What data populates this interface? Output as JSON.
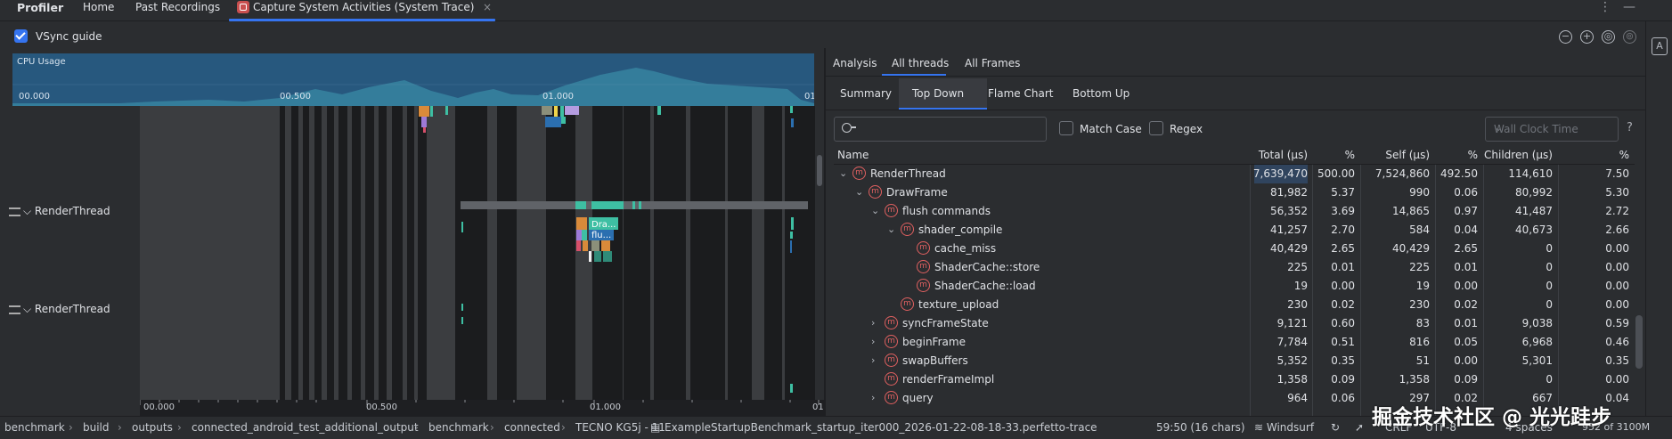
{
  "tabs": {
    "profiler": "Profiler",
    "home": "Home",
    "past_recordings": "Past Recordings",
    "capture": "Capture System Activities (System Trace)",
    "close_symbol": "×"
  },
  "toolbar": {
    "vsync_label": "VSync guide",
    "vsync_checked": true,
    "zoom_out": "−",
    "zoom_in": "+",
    "reset_zoom": "◎",
    "go_live": "⊚"
  },
  "cpu_usage": {
    "title": "CPU Usage",
    "ticks": [
      "00.000",
      "00.500",
      "01.000",
      "01"
    ]
  },
  "tracks": {
    "thread_1": "RenderThread",
    "thread_2": "RenderThread",
    "slice_labels": [
      "Dra...",
      "flu..."
    ]
  },
  "time_axis": {
    "ticks": [
      "00.000",
      "00.500",
      "01.000",
      "01"
    ]
  },
  "analysis": {
    "tabs": [
      "Analysis",
      "All threads",
      "All Frames"
    ],
    "sub_tabs": [
      "Summary",
      "Top Down",
      "Flame Chart",
      "Bottom Up"
    ],
    "search_placeholder": "",
    "match_case": "Match Case",
    "regex": "Regex",
    "clock_select": "Wall Clock Time",
    "help": "?",
    "columns": [
      "Name",
      "Total (μs)",
      "%",
      "Self (μs)",
      "%",
      "Children (μs)",
      "%"
    ],
    "rows": [
      {
        "name": "RenderThread",
        "depth": 0,
        "expand": "open",
        "total": "7,639,470",
        "total_pct": "500.00",
        "self": "7,524,860",
        "self_pct": "492.50",
        "children": "114,610",
        "children_pct": "7.50"
      },
      {
        "name": "DrawFrame",
        "depth": 1,
        "expand": "open",
        "total": "81,982",
        "total_pct": "5.37",
        "self": "990",
        "self_pct": "0.06",
        "children": "80,992",
        "children_pct": "5.30"
      },
      {
        "name": "flush commands",
        "depth": 2,
        "expand": "open",
        "total": "56,352",
        "total_pct": "3.69",
        "self": "14,865",
        "self_pct": "0.97",
        "children": "41,487",
        "children_pct": "2.72"
      },
      {
        "name": "shader_compile",
        "depth": 3,
        "expand": "open",
        "total": "41,257",
        "total_pct": "2.70",
        "self": "584",
        "self_pct": "0.04",
        "children": "40,673",
        "children_pct": "2.66"
      },
      {
        "name": "cache_miss",
        "depth": 4,
        "expand": "none",
        "total": "40,429",
        "total_pct": "2.65",
        "self": "40,429",
        "self_pct": "2.65",
        "children": "0",
        "children_pct": "0.00"
      },
      {
        "name": "ShaderCache::store",
        "depth": 4,
        "expand": "none",
        "total": "225",
        "total_pct": "0.01",
        "self": "225",
        "self_pct": "0.01",
        "children": "0",
        "children_pct": "0.00"
      },
      {
        "name": "ShaderCache::load",
        "depth": 4,
        "expand": "none",
        "total": "19",
        "total_pct": "0.00",
        "self": "19",
        "self_pct": "0.00",
        "children": "0",
        "children_pct": "0.00"
      },
      {
        "name": "texture_upload",
        "depth": 3,
        "expand": "none",
        "total": "230",
        "total_pct": "0.02",
        "self": "230",
        "self_pct": "0.02",
        "children": "0",
        "children_pct": "0.00"
      },
      {
        "name": "syncFrameState",
        "depth": 2,
        "expand": "closed",
        "total": "9,121",
        "total_pct": "0.60",
        "self": "83",
        "self_pct": "0.01",
        "children": "9,038",
        "children_pct": "0.59"
      },
      {
        "name": "beginFrame",
        "depth": 2,
        "expand": "closed",
        "total": "7,784",
        "total_pct": "0.51",
        "self": "816",
        "self_pct": "0.05",
        "children": "6,968",
        "children_pct": "0.46"
      },
      {
        "name": "swapBuffers",
        "depth": 2,
        "expand": "closed",
        "total": "5,352",
        "total_pct": "0.35",
        "self": "51",
        "self_pct": "0.00",
        "children": "5,301",
        "children_pct": "0.35"
      },
      {
        "name": "renderFrameImpl",
        "depth": 2,
        "expand": "none",
        "total": "1,358",
        "total_pct": "0.09",
        "self": "1,358",
        "self_pct": "0.09",
        "children": "0",
        "children_pct": "0.00"
      },
      {
        "name": "query",
        "depth": 2,
        "expand": "closed",
        "total": "964",
        "total_pct": "0.06",
        "self": "297",
        "self_pct": "0.02",
        "children": "667",
        "children_pct": "0.04"
      }
    ]
  },
  "status_bar": {
    "breadcrumbs": [
      "benchmark",
      "build",
      "outputs",
      "connected_android_test_additional_output",
      "benchmark",
      "connected",
      "TECNO KG5j - 11",
      "ExampleStartupBenchmark_startup_iter000_2026-01-22-08-18-33.perfetto-trace"
    ],
    "position": "59:50 (16 chars)",
    "plugin": "Windsurf",
    "line_ending": "CRLF",
    "encoding": "UTF-8",
    "indent": "4 spaces",
    "memory": "952 of 3100M"
  },
  "watermark": "掘金技术社区 @ 光光跬步",
  "colors": {
    "accent": "#3574f0",
    "cpu_fill": "#27587e",
    "method_icon": "#e06060",
    "slice_teal": "#3ebfa3",
    "slice_orange": "#d98a3a",
    "slice_purple": "#9d7ad8"
  }
}
